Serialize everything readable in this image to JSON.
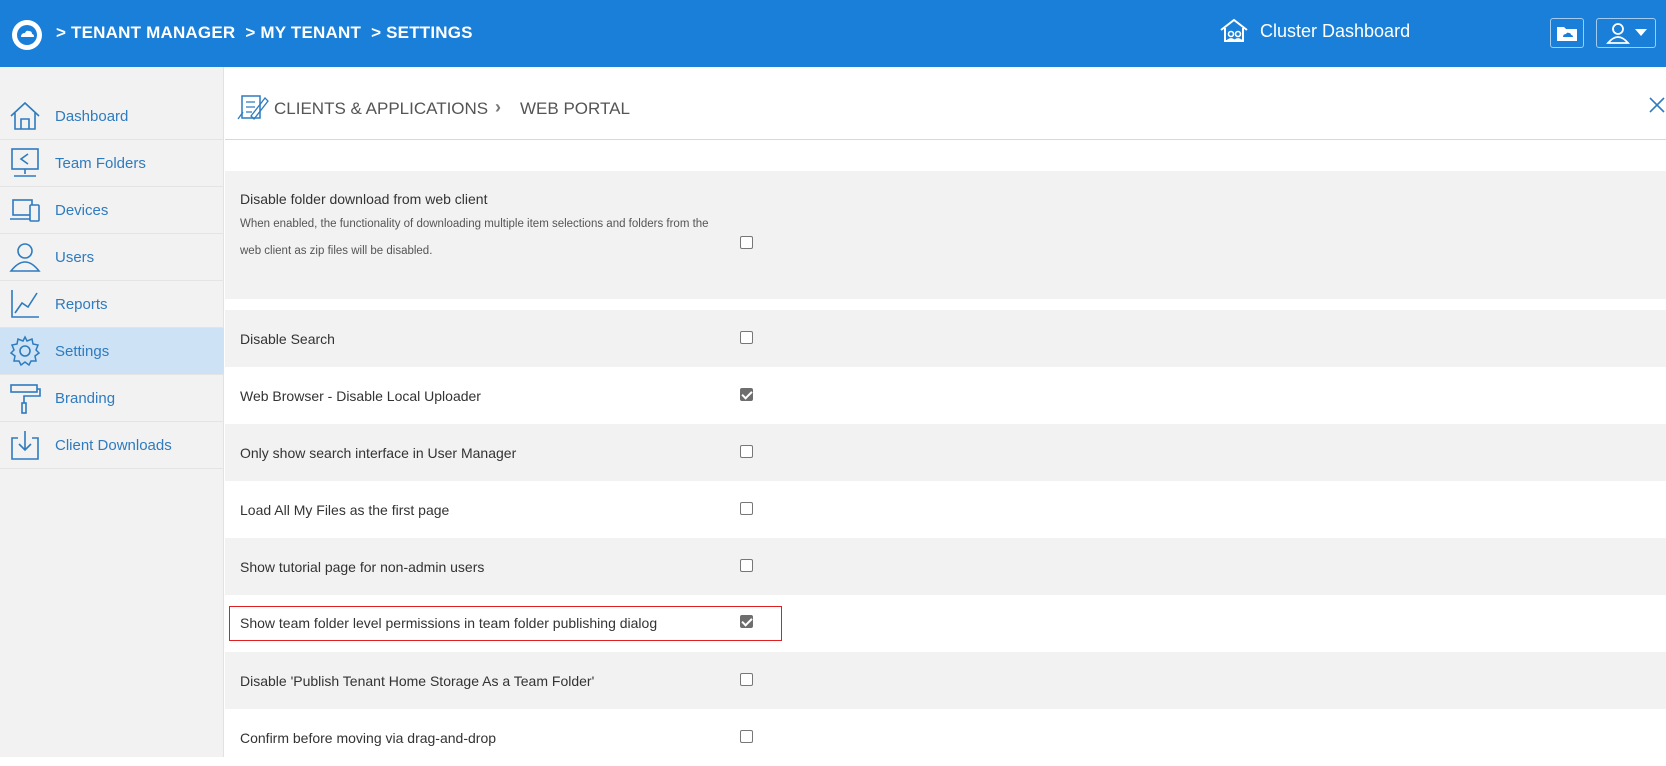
{
  "topbar": {
    "breadcrumbs": [
      "> TENANT MANAGER",
      "> MY TENANT",
      "> SETTINGS"
    ],
    "cluster_label": "Cluster Dashboard"
  },
  "sidebar": {
    "items": [
      {
        "label": "Dashboard",
        "icon": "home-icon",
        "active": false
      },
      {
        "label": "Team Folders",
        "icon": "team-folders-icon",
        "active": false
      },
      {
        "label": "Devices",
        "icon": "devices-icon",
        "active": false
      },
      {
        "label": "Users",
        "icon": "users-icon",
        "active": false
      },
      {
        "label": "Reports",
        "icon": "reports-chart-icon",
        "active": false
      },
      {
        "label": "Settings",
        "icon": "gear-icon",
        "active": true
      },
      {
        "label": "Branding",
        "icon": "paint-roller-icon",
        "active": false
      },
      {
        "label": "Client Downloads",
        "icon": "download-icon",
        "active": false
      }
    ]
  },
  "content": {
    "breadcrumb_1": "CLIENTS & APPLICATIONS",
    "breadcrumb_2": "WEB PORTAL"
  },
  "settings": [
    {
      "label": "Disable folder download from web client",
      "description": "When enabled, the functionality of downloading multiple item selections and folders from the web client as zip files will be disabled.",
      "checked": false
    },
    {
      "label": "Disable Search",
      "checked": false
    },
    {
      "label": "Web Browser - Disable Local Uploader",
      "checked": true
    },
    {
      "label": "Only show search interface in User Manager",
      "checked": false
    },
    {
      "label": "Load All My Files as the first page",
      "checked": false
    },
    {
      "label": "Show tutorial page for non-admin users",
      "checked": false
    },
    {
      "label": "Show team folder level permissions in team folder publishing dialog",
      "checked": true,
      "highlighted": true
    },
    {
      "label": "Disable 'Publish Tenant Home Storage As a Team Folder'",
      "checked": false
    },
    {
      "label": "Confirm before moving via drag-and-drop",
      "checked": false
    }
  ],
  "colors": {
    "topbar": "#1a7fd9",
    "sidebar_active": "#cde3f5",
    "highlight_border": "#e02020",
    "nav_text": "#2e7bbf"
  }
}
